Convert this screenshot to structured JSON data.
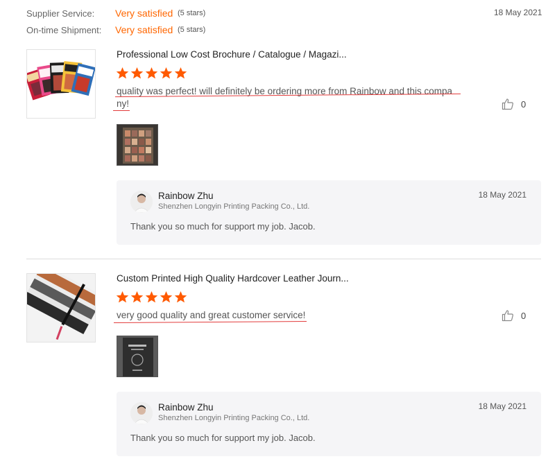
{
  "ratings": {
    "supplier_label": "Supplier Service:",
    "supplier_value": "Very satisfied",
    "supplier_stars": "(5 stars)",
    "shipment_label": "On-time Shipment:",
    "shipment_value": "Very satisfied",
    "shipment_stars": "(5 stars)",
    "date": "18 May 2021"
  },
  "reviews": [
    {
      "title": "Professional Low Cost Brochure / Catalogue / Magazi...",
      "rating": 5,
      "comment_line1": "quality was perfect! will definitely be ordering more from Rainbow and this compa",
      "comment_line2": "ny!",
      "likes": "0",
      "reply": {
        "name": "Rainbow Zhu",
        "company": "Shenzhen Longyin Printing Packing Co., Ltd.",
        "date": "18 May 2021",
        "text": "Thank you so much for support my job. Jacob."
      }
    },
    {
      "title": "Custom Printed High Quality Hardcover Leather Journ...",
      "rating": 5,
      "comment_line1": "very good quality and great customer service!",
      "likes": "0",
      "reply": {
        "name": "Rainbow Zhu",
        "company": "Shenzhen Longyin Printing Packing Co., Ltd.",
        "date": "18 May 2021",
        "text": "Thank you so much for support my job. Jacob."
      }
    }
  ],
  "colors": {
    "accent": "#ff6600",
    "underline": "#e23a3a",
    "reply_bg": "#f5f5f7"
  },
  "icons": {
    "star": "star-icon",
    "like": "thumbs-up-icon"
  }
}
